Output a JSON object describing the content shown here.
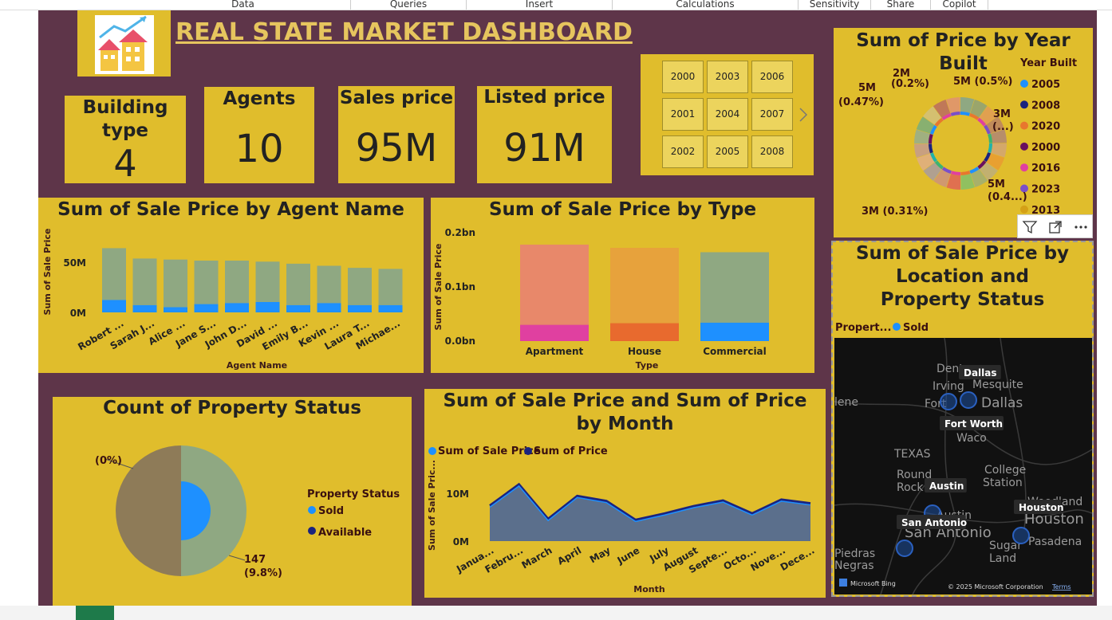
{
  "ribbon": {
    "tabs": [
      "Data",
      "Queries",
      "Insert",
      "Calculations",
      "Sensitivity",
      "Share",
      "Copilot"
    ]
  },
  "dashboard": {
    "title": "REAL STATE  MARKET DASHBOARD",
    "logo_icon": "house-growth-icon"
  },
  "kpis": [
    {
      "label": "Building type",
      "value": "4"
    },
    {
      "label": "Agents",
      "value": "10"
    },
    {
      "label": "Sales price",
      "value": "95M"
    },
    {
      "label": "Listed price",
      "value": "91M"
    }
  ],
  "year_slicer": {
    "years": [
      "2000",
      "2003",
      "2006",
      "2001",
      "2004",
      "2007",
      "2002",
      "2005",
      "2008"
    ],
    "next_icon": "chevron-right-icon"
  },
  "donut_year": {
    "title": "Sum of Price by Year Built",
    "legend_title": "Year Built",
    "legend": [
      {
        "label": "2005",
        "color": "#1e90ff"
      },
      {
        "label": "2008",
        "color": "#1a237e"
      },
      {
        "label": "2020",
        "color": "#e8772e"
      },
      {
        "label": "2000",
        "color": "#6a0f5f"
      },
      {
        "label": "2016",
        "color": "#e040a0"
      },
      {
        "label": "2023",
        "color": "#7b4fc9"
      },
      {
        "label": "2013",
        "color": "#d4a017"
      }
    ],
    "annotations": [
      "2M",
      "(0.2%)",
      "5M (0.5%)",
      "5M",
      "(0.47%)",
      "3M",
      "(...)",
      "5M",
      "(0.4...)",
      "3M (0.31%)"
    ]
  },
  "visual_header": {
    "icons": [
      "filter-icon",
      "focus-mode-icon",
      "more-options-icon"
    ]
  },
  "agent_chart": {
    "title": "Sum of Sale Price by Agent Name",
    "chart_data": {
      "type": "bar",
      "xlabel": "Agent Name",
      "ylabel": "Sum of Sale Price",
      "y_ticks": [
        "50M",
        "0M"
      ],
      "categories": [
        "Robert ...",
        "Sarah J...",
        "Alice ...",
        "Jane S...",
        "John D...",
        "David ...",
        "Emily B...",
        "Kevin ...",
        "Laura T...",
        "Michae..."
      ],
      "ylim": [
        0,
        70
      ],
      "series": [
        {
          "color": "#8fa882",
          "values": [
            62,
            52,
            51,
            50,
            50,
            49,
            47,
            45,
            43,
            42
          ]
        },
        {
          "color": "#1e90ff",
          "values": [
            12,
            7,
            5,
            8,
            9,
            10,
            7,
            9,
            7,
            7
          ]
        }
      ]
    }
  },
  "type_chart": {
    "title": "Sum of Sale Price by Type",
    "chart_data": {
      "type": "bar",
      "xlabel": "Type",
      "ylabel": "Sum of Sale Price",
      "y_ticks": [
        "0.2bn",
        "0.1bn",
        "0.0bn"
      ],
      "categories": [
        "Apartment",
        "House",
        "Commercial"
      ],
      "ylim": [
        0,
        0.2
      ],
      "bars": [
        {
          "total": 0.178,
          "part": 0.03,
          "color": "#e8886a",
          "part_color": "#e040a0"
        },
        {
          "total": 0.172,
          "part": 0.033,
          "color": "#e7a23c",
          "part_color": "#e86a2e"
        },
        {
          "total": 0.164,
          "part": 0.034,
          "color": "#8fa882",
          "part_color": "#1e90ff"
        }
      ]
    }
  },
  "status_chart": {
    "title": "Count of Property Status",
    "legend_title": "Property Status",
    "legend": [
      {
        "label": "Sold",
        "color": "#1e90ff"
      },
      {
        "label": "Available",
        "color": "#1a237e"
      }
    ],
    "annotations": [
      "(0%)",
      "147",
      "(9.8%)"
    ],
    "chart_data": {
      "type": "pie",
      "slices": [
        {
          "label": "Sold",
          "value": 50
        },
        {
          "label": "Available",
          "value": 50
        }
      ]
    }
  },
  "month_chart": {
    "title": "Sum of Sale Price and Sum of Price by Month",
    "legend": [
      {
        "label": "Sum of Sale Price",
        "color": "#1e90ff"
      },
      {
        "label": "Sum of Price",
        "color": "#1a237e"
      }
    ],
    "chart_data": {
      "type": "area",
      "xlabel": "Month",
      "ylabel": "Sum of Sale Pric...",
      "y_ticks": [
        "10M",
        "0M"
      ],
      "categories": [
        "Janua...",
        "Febru...",
        "March",
        "April",
        "May",
        "June",
        "July",
        "August",
        "Septe...",
        "Octo...",
        "Nove...",
        "Dece..."
      ],
      "ylim": [
        0,
        14
      ],
      "series": [
        {
          "name": "Sum of Sale Price",
          "values": [
            7.7,
            12.3,
            4.8,
            9.8,
            8.7,
            4.6,
            6.0,
            7.6,
            8.8,
            6.0,
            9.0,
            8.2
          ]
        }
      ]
    }
  },
  "map_chart": {
    "title": "Sum of Sale Price by Location and Property Status",
    "legend_title": "Propert...",
    "legend_item": "Sold",
    "cities": [
      "Dallas",
      "Fort Worth",
      "Austin",
      "Houston",
      "San Antonio"
    ],
    "base_labels": [
      "Irving",
      "Mesquite",
      "Dallas",
      "Fort",
      "Waco",
      "TEXAS",
      "College",
      "Station",
      "Round",
      "Rock",
      "Austin",
      "Woodland",
      "Houston",
      "San Antonio",
      "Sugar",
      "Land",
      "Pasadena",
      "Piedras",
      "Negras",
      "lene",
      "Dent"
    ],
    "attribution": [
      "Microsoft Bing",
      "© 2025 Microsoft Corporation",
      "Terms"
    ]
  }
}
